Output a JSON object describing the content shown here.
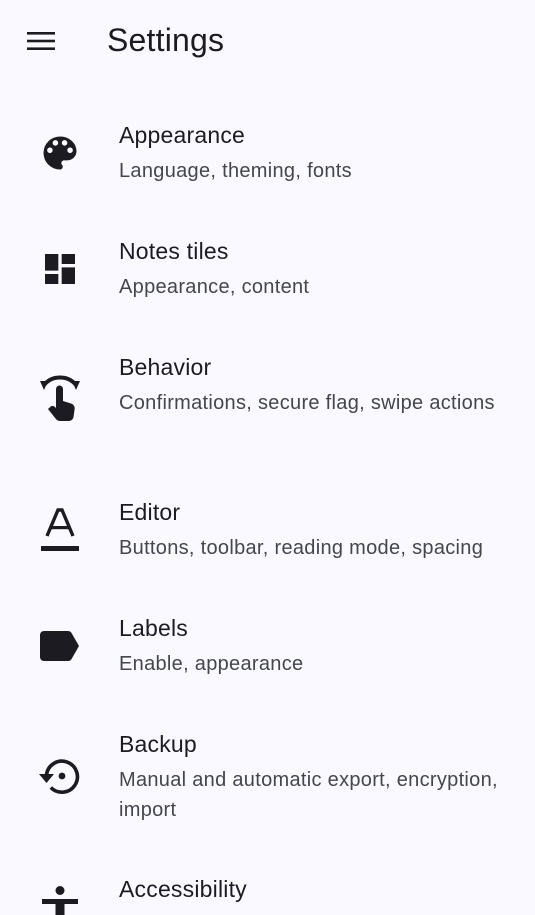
{
  "header": {
    "menu_icon": "menu-icon",
    "title": "Settings"
  },
  "settings": {
    "items": [
      {
        "icon": "palette-icon",
        "title": "Appearance",
        "subtitle": "Language, theming, fonts"
      },
      {
        "icon": "dashboard-icon",
        "title": "Notes tiles",
        "subtitle": "Appearance, content"
      },
      {
        "icon": "swipe-gesture-icon",
        "title": "Behavior",
        "subtitle": "Confirmations, secure flag, swipe actions"
      },
      {
        "icon": "text-format-icon",
        "title": "Editor",
        "subtitle": "Buttons, toolbar, reading mode, spacing"
      },
      {
        "icon": "label-icon",
        "title": "Labels",
        "subtitle": "Enable, appearance"
      },
      {
        "icon": "restore-icon",
        "title": "Backup",
        "subtitle": "Manual and automatic export, encryption, import"
      },
      {
        "icon": "accessibility-icon",
        "title": "Accessibility",
        "subtitle": ""
      }
    ]
  },
  "colors": {
    "background": "#f9f9ff",
    "text_primary": "#1b1b21",
    "text_secondary": "#44464f"
  }
}
